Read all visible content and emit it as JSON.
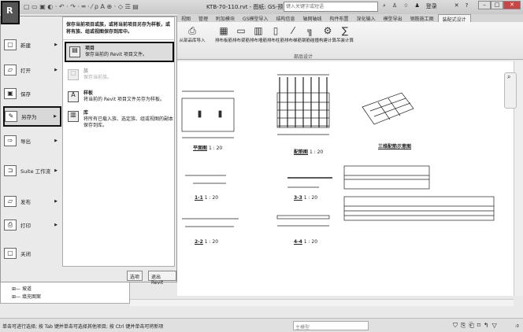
{
  "titlebar": {
    "doc_title": "KTB-70-110.rvt - 图纸: GS-预...",
    "search_placeholder": "键入关键字或短语",
    "login": "登录",
    "help": "?"
  },
  "tabs": [
    "视图",
    "管理",
    "附加模块",
    "GS模型导入",
    "结构信息",
    "轴网轴线",
    "构件布置",
    "深化输入",
    "模型导出",
    "钢筋施工图",
    "装配式设计"
  ],
  "active_tab": "装配式设计",
  "ribbon": {
    "buttons": [
      "从部品库导入",
      "排布板筋",
      "排布梁筋",
      "排布墙筋",
      "排布柱筋",
      "排布梯筋",
      "钢筋碰撞",
      "构建计算",
      "吊装计算"
    ],
    "group": "部品设计"
  },
  "menu": {
    "left": [
      {
        "label": "新建",
        "arrow": true
      },
      {
        "label": "打开",
        "arrow": true
      },
      {
        "label": "保存",
        "arrow": false
      },
      {
        "label": "另存为",
        "arrow": true
      },
      {
        "label": "导出",
        "arrow": true
      },
      {
        "label": "Suite 工作流",
        "arrow": true
      },
      {
        "label": "发布",
        "arrow": true
      },
      {
        "label": "打印",
        "arrow": true
      },
      {
        "label": "关闭",
        "arrow": false
      }
    ],
    "header": "保存当前项目或族，或将当前项目另存为样板，或将有族、组或视图保存到库中。",
    "right": [
      {
        "title": "项目",
        "desc": "保存当前的 Revit 项目文件。"
      },
      {
        "title": "族",
        "desc": "保存当前族。"
      },
      {
        "title": "样板",
        "desc": "将当前的 Revit 项目文件另存为样板。"
      },
      {
        "title": "库",
        "desc": "将所有已载入族、选定族、组或视图的副本保存到库。"
      }
    ],
    "options": "选项",
    "exit": "退出 Revit"
  },
  "browser": {
    "items": [
      "坡道",
      "填充图案"
    ]
  },
  "drawing": {
    "views": [
      {
        "title": "平面图",
        "scale": "1 : 20"
      },
      {
        "title": "配筋图",
        "scale": "1 : 20"
      },
      {
        "title": "三维配筋示意图",
        "scale": ""
      },
      {
        "title": "1-1",
        "scale": "1 : 20"
      },
      {
        "title": "3-3",
        "scale": "1 : 20"
      },
      {
        "title": "2-2",
        "scale": "1 : 20"
      },
      {
        "title": "4-4",
        "scale": "1 : 20"
      }
    ]
  },
  "status": {
    "hint": "单击可进行选择; 按 Tab 键并单击可选择其他项目; 按 Ctrl 键并单击可将新项",
    "model": "主模型",
    "filter_count": ":0"
  }
}
